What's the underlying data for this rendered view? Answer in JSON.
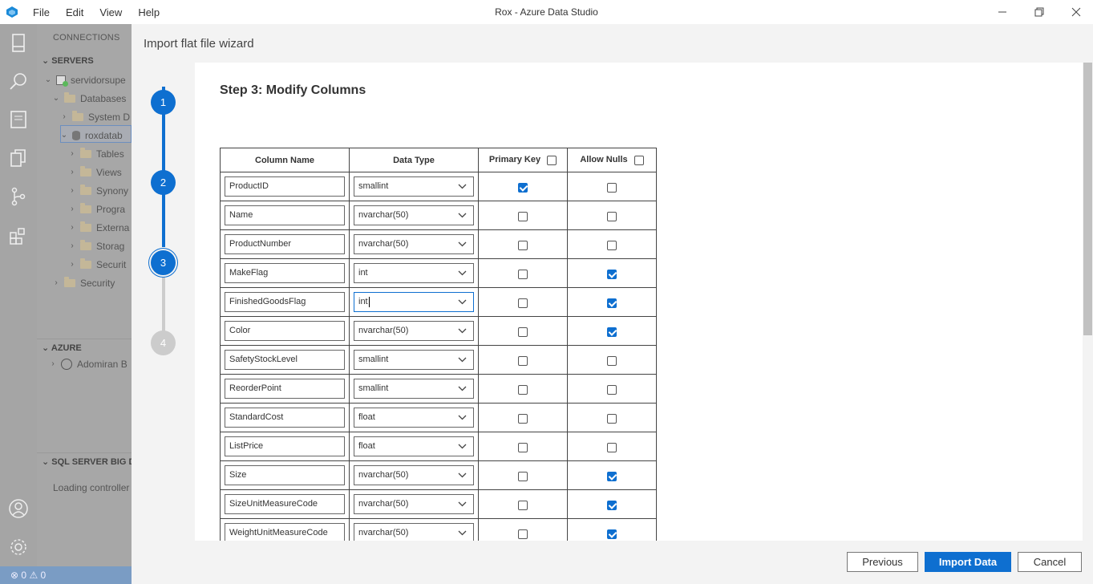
{
  "window": {
    "title": "Rox - Azure Data Studio",
    "menu": [
      "File",
      "Edit",
      "View",
      "Help"
    ],
    "controls": {
      "minimize": "—",
      "restore": "❐",
      "close": "✕"
    }
  },
  "sidebar": {
    "title": "CONNECTIONS",
    "servers_label": "SERVERS",
    "tree": [
      {
        "label": "servidorsupe",
        "icon": "server-icon"
      },
      {
        "label": "Databases"
      },
      {
        "label": "System D"
      },
      {
        "label": "roxdatab",
        "icon": "database-icon"
      },
      {
        "label": "Tables"
      },
      {
        "label": "Views"
      },
      {
        "label": "Synony"
      },
      {
        "label": "Progra"
      },
      {
        "label": "Externa"
      },
      {
        "label": "Storag"
      },
      {
        "label": "Securit"
      },
      {
        "label": "Security"
      }
    ],
    "azure_label": "AZURE",
    "azure_account": "Adomiran B",
    "bigdata_label": "SQL SERVER BIG DA",
    "bigdata_status": "Loading controller"
  },
  "statusbar": {
    "errors": "0",
    "warnings": "0"
  },
  "wizard": {
    "title": "Import flat file wizard",
    "steps": [
      "1",
      "2",
      "3",
      "4"
    ],
    "current_step": 3,
    "heading": "Step 3: Modify Columns",
    "columns_header": {
      "name": "Column Name",
      "type": "Data Type",
      "pk": "Primary Key",
      "nulls": "Allow Nulls"
    },
    "rows": [
      {
        "name": "ProductID",
        "type": "smallint",
        "pk": true,
        "nulls": false
      },
      {
        "name": "Name",
        "type": "nvarchar(50)",
        "pk": false,
        "nulls": false
      },
      {
        "name": "ProductNumber",
        "type": "nvarchar(50)",
        "pk": false,
        "nulls": false
      },
      {
        "name": "MakeFlag",
        "type": "int",
        "pk": false,
        "nulls": true
      },
      {
        "name": "FinishedGoodsFlag",
        "type": "int",
        "pk": false,
        "nulls": true
      },
      {
        "name": "Color",
        "type": "nvarchar(50)",
        "pk": false,
        "nulls": true
      },
      {
        "name": "SafetyStockLevel",
        "type": "smallint",
        "pk": false,
        "nulls": false
      },
      {
        "name": "ReorderPoint",
        "type": "smallint",
        "pk": false,
        "nulls": false
      },
      {
        "name": "StandardCost",
        "type": "float",
        "pk": false,
        "nulls": false
      },
      {
        "name": "ListPrice",
        "type": "float",
        "pk": false,
        "nulls": false
      },
      {
        "name": "Size",
        "type": "nvarchar(50)",
        "pk": false,
        "nulls": true
      },
      {
        "name": "SizeUnitMeasureCode",
        "type": "nvarchar(50)",
        "pk": false,
        "nulls": true
      },
      {
        "name": "WeightUnitMeasureCode",
        "type": "nvarchar(50)",
        "pk": false,
        "nulls": true
      }
    ],
    "buttons": {
      "previous": "Previous",
      "import": "Import Data",
      "cancel": "Cancel"
    }
  },
  "colors": {
    "accent": "#0e6fd0",
    "step_inactive": "#cccccc"
  }
}
